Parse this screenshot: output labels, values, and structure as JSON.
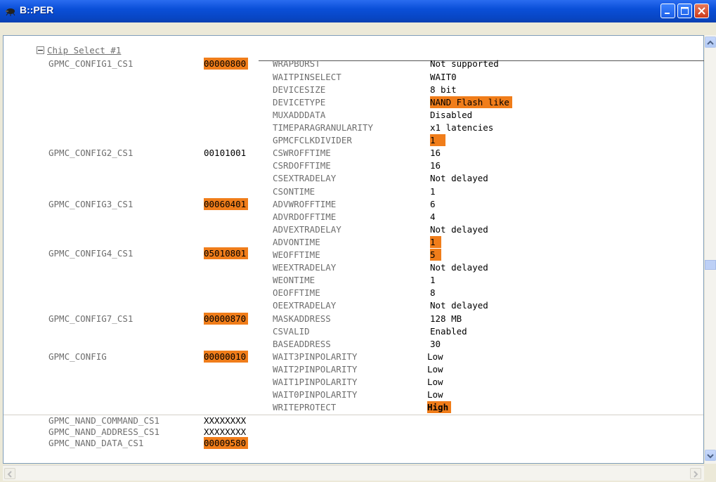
{
  "window": {
    "title": "B::PER"
  },
  "tree": {
    "header": "Chip Select #1"
  },
  "registers": [
    {
      "name": "GPMC_CONFIG1_CS1",
      "value": "00000800",
      "highlight": true
    },
    {
      "name": "GPMC_CONFIG2_CS1",
      "value": "00101001",
      "highlight": false
    },
    {
      "name": "GPMC_CONFIG3_CS1",
      "value": "00060401",
      "highlight": true
    },
    {
      "name": "GPMC_CONFIG4_CS1",
      "value": "05010801",
      "highlight": true
    },
    {
      "name": "GPMC_CONFIG7_CS1",
      "value": "00000870",
      "highlight": true
    },
    {
      "name": "GPMC_CONFIG",
      "value": "00000010",
      "highlight": true
    },
    {
      "name": "GPMC_NAND_COMMAND_CS1",
      "value": "XXXXXXXX",
      "highlight": false
    },
    {
      "name": "GPMC_NAND_ADDRESS_CS1",
      "value": "XXXXXXXX",
      "highlight": false
    },
    {
      "name": "GPMC_NAND_DATA_CS1",
      "value": "00009580",
      "highlight": true
    }
  ],
  "fields": [
    {
      "name": "WRAPBURST",
      "value": "Not supported",
      "highlight": false
    },
    {
      "name": "WAITPINSELECT",
      "value": "WAIT0",
      "highlight": false
    },
    {
      "name": "DEVICESIZE",
      "value": "8 bit",
      "highlight": false
    },
    {
      "name": "DEVICETYPE",
      "value": "NAND Flash like",
      "highlight": true
    },
    {
      "name": "MUXADDDATA",
      "value": "Disabled",
      "highlight": false
    },
    {
      "name": "TIMEPARAGRANULARITY",
      "value": "x1 latencies",
      "highlight": false
    },
    {
      "name": "GPMCFCLKDIVIDER",
      "value": "1",
      "highlight": true
    },
    {
      "name": "CSWROFFTIME",
      "value": "16",
      "highlight": false
    },
    {
      "name": "CSRDOFFTIME",
      "value": "16",
      "highlight": false
    },
    {
      "name": "CSEXTRADELAY",
      "value": "Not delayed",
      "highlight": false
    },
    {
      "name": "CSONTIME",
      "value": "1",
      "highlight": false
    },
    {
      "name": "ADVWROFFTIME",
      "value": "6",
      "highlight": false
    },
    {
      "name": "ADVRDOFFTIME",
      "value": "4",
      "highlight": false
    },
    {
      "name": "ADVEXTRADELAY",
      "value": "Not delayed",
      "highlight": false
    },
    {
      "name": "ADVONTIME",
      "value": "1",
      "highlight": true
    },
    {
      "name": "WEOFFTIME",
      "value": "5",
      "highlight": true
    },
    {
      "name": "WEEXTRADELAY",
      "value": "Not delayed",
      "highlight": false
    },
    {
      "name": "WEONTIME",
      "value": "1",
      "highlight": false
    },
    {
      "name": "OEOFFTIME",
      "value": "8",
      "highlight": false
    },
    {
      "name": "OEEXTRADELAY",
      "value": "Not delayed",
      "highlight": false
    },
    {
      "name": "MASKADDRESS",
      "value": "128 MB",
      "highlight": false
    },
    {
      "name": "CSVALID",
      "value": "Enabled",
      "highlight": false
    },
    {
      "name": "BASEADDRESS",
      "value": "30",
      "highlight": false
    },
    {
      "name": "WAIT3PINPOLARITY",
      "value": "Low",
      "highlight": false
    },
    {
      "name": "WAIT2PINPOLARITY",
      "value": "Low",
      "highlight": false
    },
    {
      "name": "WAIT1PINPOLARITY",
      "value": "Low",
      "highlight": false
    },
    {
      "name": "WAIT0PINPOLARITY",
      "value": "Low",
      "highlight": false
    },
    {
      "name": "WRITEPROTECT",
      "value": "High",
      "highlight": true
    }
  ],
  "colors": {
    "highlight": "#f07d1a",
    "title_bar": "#0a4fd8"
  }
}
